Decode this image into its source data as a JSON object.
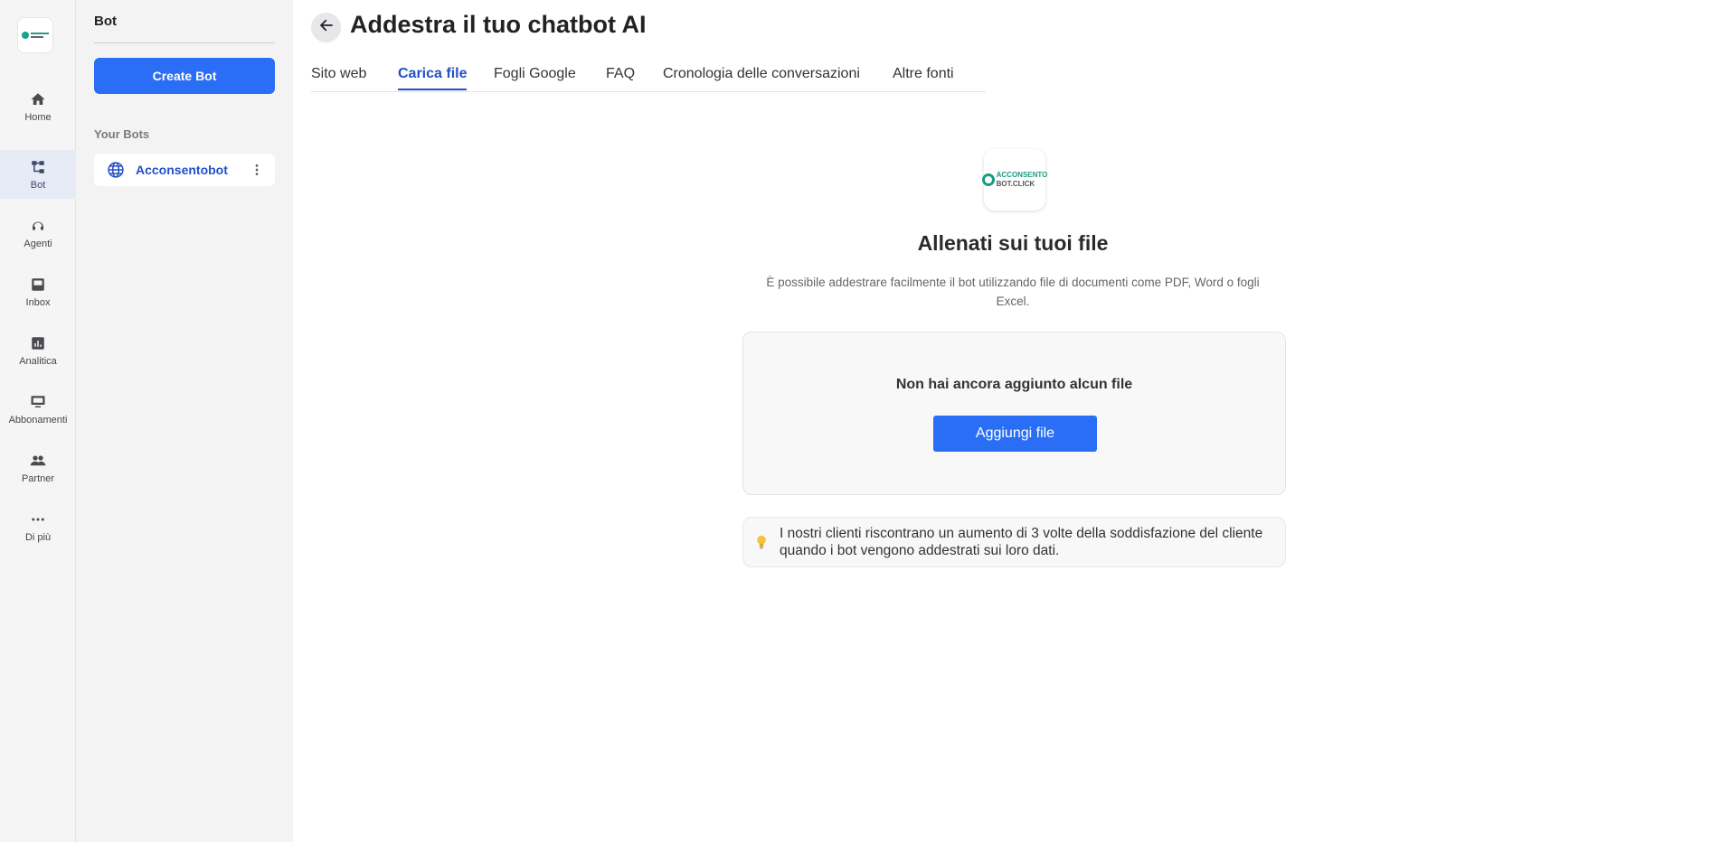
{
  "rail": {
    "items": [
      {
        "label": "Home",
        "icon": "home-icon"
      },
      {
        "label": "Bot",
        "icon": "bot-tree-icon"
      },
      {
        "label": "Agenti",
        "icon": "agent-headset-icon"
      },
      {
        "label": "Inbox",
        "icon": "inbox-icon"
      },
      {
        "label": "Analitica",
        "icon": "analytics-icon"
      },
      {
        "label": "Abbonamenti",
        "icon": "subscriptions-icon"
      },
      {
        "label": "Partner",
        "icon": "partner-people-icon"
      },
      {
        "label": "Di più",
        "icon": "more-dots-icon"
      }
    ],
    "active": "Bot"
  },
  "sidebar": {
    "title": "Bot",
    "create_label": "Create Bot",
    "section_label": "Your Bots",
    "bots": [
      {
        "name": "Acconsentobot",
        "icon": "globe-icon"
      }
    ]
  },
  "header": {
    "title": "Addestra il tuo chatbot AI"
  },
  "tabs": [
    {
      "label": "Sito web"
    },
    {
      "label": "Carica file"
    },
    {
      "label": "Fogli Google"
    },
    {
      "label": "FAQ"
    },
    {
      "label": "Cronologia delle conversazioni"
    },
    {
      "label": "Altre fonti"
    }
  ],
  "active_tab": "Carica file",
  "logo": {
    "line1": "ACCONSENTO",
    "line2": "BOT.CLICK"
  },
  "main": {
    "title": "Allenati sui tuoi file",
    "description": "È possibile addestrare facilmente il bot utilizzando file di documenti come PDF, Word o fogli Excel.",
    "empty_message": "Non hai ancora aggiunto alcun file",
    "add_button": "Aggiungi file",
    "tip": "I nostri clienti riscontrano un aumento di 3 volte della soddisfazione del cliente quando i bot vengono addestrati sui loro dati."
  },
  "colors": {
    "primary": "#2b6ef6",
    "accent_text": "#2250c9",
    "brand_green": "#1b9c84"
  }
}
